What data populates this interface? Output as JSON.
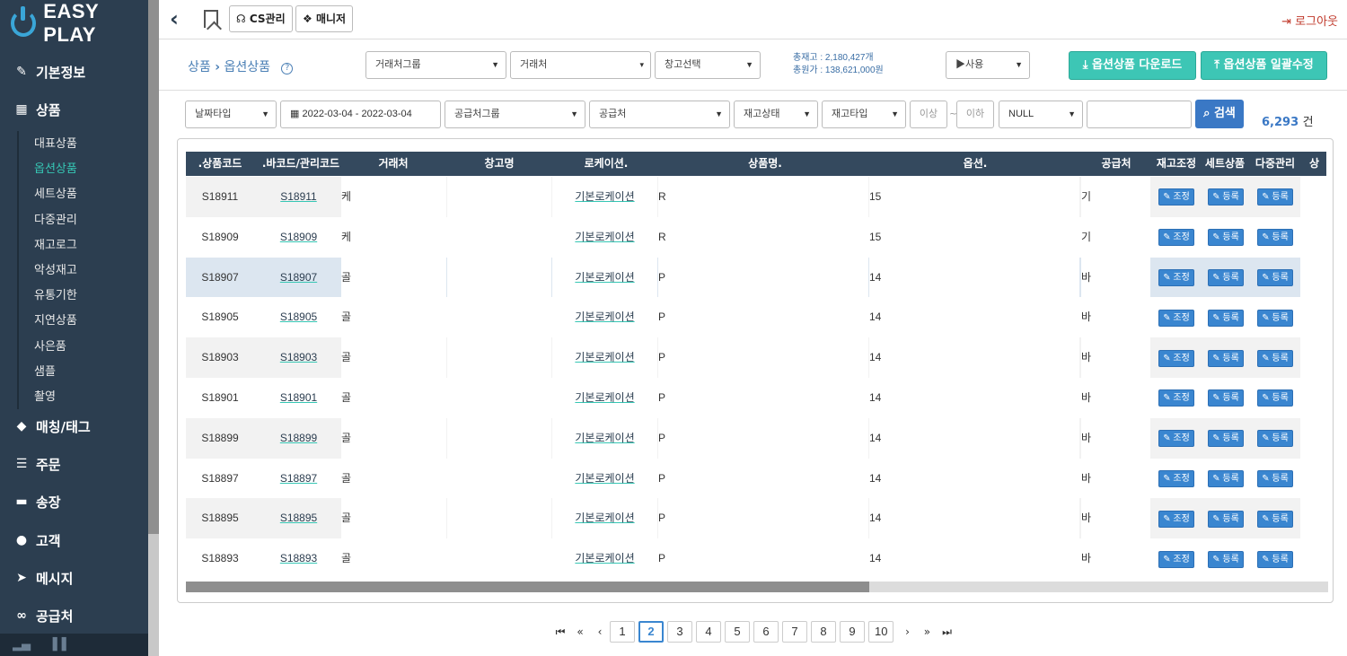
{
  "app": {
    "logo": "EASY PLAY"
  },
  "sidebar": {
    "menus": [
      {
        "icon": "edit-icon",
        "glyph": "✎",
        "label": "기본정보"
      },
      {
        "icon": "table-icon",
        "glyph": "▦",
        "label": "상품"
      },
      {
        "icon": "tag-icon",
        "glyph": "◆",
        "label": "매칭/태그"
      },
      {
        "icon": "list-icon",
        "glyph": "☰",
        "label": "주문"
      },
      {
        "icon": "truck-icon",
        "glyph": "▬",
        "label": "송장"
      },
      {
        "icon": "users-icon",
        "glyph": "●",
        "label": "고객"
      },
      {
        "icon": "send-icon",
        "glyph": "➤",
        "label": "메시지"
      },
      {
        "icon": "link-icon",
        "glyph": "∞",
        "label": "공급처"
      }
    ],
    "submenu": [
      "대표상품",
      "옵션상품",
      "세트상품",
      "다중관리",
      "재고로그",
      "악성재고",
      "유통기한",
      "지연상품",
      "사은품",
      "샘플",
      "촬영"
    ],
    "active_sub": "옵션상품"
  },
  "topbar": {
    "cs": "CS관리",
    "manual": "매니저",
    "logout": "로그아웃"
  },
  "breadcrumb": {
    "parent": "상품",
    "current": "옵션상품"
  },
  "filters1": {
    "partner_group": "거래처그룹",
    "partner": "거래처",
    "warehouse": "창고선택",
    "usage": "▶사용"
  },
  "stock": {
    "total_stock": "총재고 : 2,180,427개",
    "total_cost": "총원가 : 138,621,000원"
  },
  "buttons": {
    "download": "옵션상품 다운로드",
    "bulk_edit": "옵션상품 일괄수정",
    "search": "검색"
  },
  "filters2": {
    "date_type": "날짜타입",
    "date_range": "2022-03-04 - 2022-03-04",
    "supplier_group": "공급처그룹",
    "supplier": "공급처",
    "stock_status": "재고상태",
    "stock_type": "재고타입",
    "min": "이상",
    "tilde": "~",
    "max": "이하",
    "null_sel": "NULL",
    "search_value": ""
  },
  "result": {
    "count": "6,293",
    "unit": "건"
  },
  "table": {
    "headers": [
      ".상품코드",
      ".바코드/관리코드",
      "거래처",
      "창고명",
      "로케이션.",
      "상품명.",
      "옵션.",
      "공급처",
      "재고조정",
      "세트상품",
      "다중관리",
      "상"
    ],
    "btn_adjust": "조정",
    "btn_register": "등록",
    "rows": [
      {
        "code": "S18911",
        "barcode": "S18911",
        "partner": "케",
        "location": "기본로케이션",
        "name": "R",
        "option": "15",
        "supplier": "기"
      },
      {
        "code": "S18909",
        "barcode": "S18909",
        "partner": "케",
        "location": "기본로케이션",
        "name": "R",
        "option": "15",
        "supplier": "기"
      },
      {
        "code": "S18907",
        "barcode": "S18907",
        "partner": "골",
        "location": "기본로케이션",
        "name": "P",
        "option": "14",
        "supplier": "바"
      },
      {
        "code": "S18905",
        "barcode": "S18905",
        "partner": "골",
        "location": "기본로케이션",
        "name": "P",
        "option": "14",
        "supplier": "바"
      },
      {
        "code": "S18903",
        "barcode": "S18903",
        "partner": "골",
        "location": "기본로케이션",
        "name": "P",
        "option": "14",
        "supplier": "바"
      },
      {
        "code": "S18901",
        "barcode": "S18901",
        "partner": "골",
        "location": "기본로케이션",
        "name": "P",
        "option": "14",
        "supplier": "바"
      },
      {
        "code": "S18899",
        "barcode": "S18899",
        "partner": "골",
        "location": "기본로케이션",
        "name": "P",
        "option": "14",
        "supplier": "바"
      },
      {
        "code": "S18897",
        "barcode": "S18897",
        "partner": "골",
        "location": "기본로케이션",
        "name": "P",
        "option": "14",
        "supplier": "바"
      },
      {
        "code": "S18895",
        "barcode": "S18895",
        "partner": "골",
        "location": "기본로케이션",
        "name": "P",
        "option": "14",
        "supplier": "바"
      },
      {
        "code": "S18893",
        "barcode": "S18893",
        "partner": "골",
        "location": "기본로케이션",
        "name": "P",
        "option": "14",
        "supplier": "바"
      }
    ]
  },
  "pagination": {
    "pages": [
      "1",
      "2",
      "3",
      "4",
      "5",
      "6",
      "7",
      "8",
      "9",
      "10"
    ],
    "current": "2"
  }
}
